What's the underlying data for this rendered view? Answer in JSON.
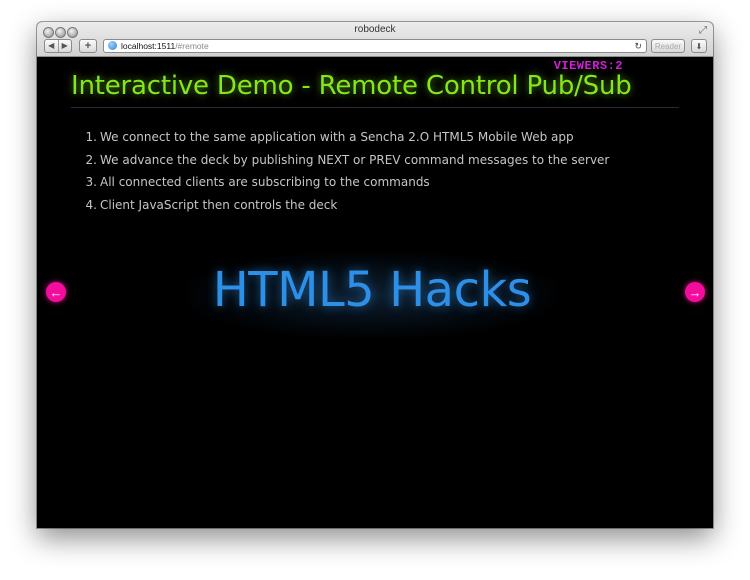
{
  "window": {
    "title": "robodeck",
    "fullscreen_icon": "fullscreen-arrows-icon"
  },
  "toolbar": {
    "back_glyph": "◀",
    "forward_glyph": "▶",
    "add_glyph": "+",
    "url_host": "localhost:1511",
    "url_path": "/#remote",
    "reload_glyph": "↻",
    "reader_label": "Reader",
    "download_glyph": "⬇"
  },
  "slide": {
    "viewers": "VIEWERS:2",
    "title": "Interactive Demo - Remote Control Pub/Sub",
    "bullets": [
      {
        "num": "1.",
        "text": "We connect to the same application with a Sencha 2.O HTML5 Mobile Web app"
      },
      {
        "num": "2.",
        "text": "We advance the deck by publishing NEXT or PREV command messages to the server"
      },
      {
        "num": "3.",
        "text": "All connected clients are subscribing to the commands"
      },
      {
        "num": "4.",
        "text": "Client JavaScript then controls the deck"
      }
    ],
    "hero_text": "HTML5 Hacks",
    "prev_glyph": "←",
    "next_glyph": "→"
  },
  "colors": {
    "title": "#86e61a",
    "viewers": "#d21fd6",
    "hero": "#2e8fe6",
    "nav_arrows": "#f20d9c",
    "bullets": "#c6c6c6"
  }
}
